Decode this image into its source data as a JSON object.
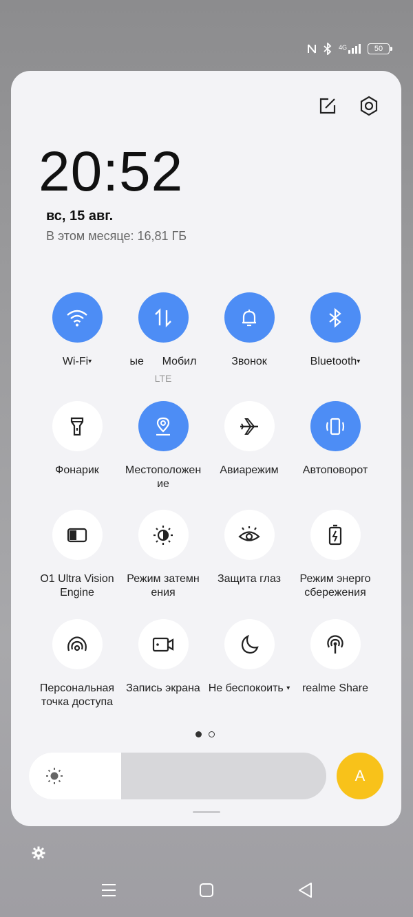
{
  "status_bar": {
    "icons": [
      "nfc-icon",
      "bluetooth-icon",
      "signal-4g-icon"
    ],
    "network": "4G",
    "battery": "50"
  },
  "panel": {
    "edit_icon": "edit-icon",
    "settings_icon": "gear-icon",
    "time": "20:52",
    "date": "вс, 15 авг.",
    "data_usage": "В этом месяце: 16,81 ГБ"
  },
  "tiles": [
    {
      "label": "Wi-Fi",
      "caret": "▾",
      "state": "on",
      "icon": "wifi-icon"
    },
    {
      "label": "ые      Мобил",
      "sub": "LTE",
      "state": "on",
      "icon": "mobile-data-icon"
    },
    {
      "label": "Звонок",
      "state": "on",
      "icon": "bell-icon"
    },
    {
      "label": "Bluetooth",
      "caret": "▾",
      "state": "on",
      "icon": "bluetooth-icon"
    },
    {
      "label": "Фонарик",
      "state": "off",
      "icon": "flashlight-icon"
    },
    {
      "label": "Местоположен\nие",
      "state": "on",
      "icon": "location-icon"
    },
    {
      "label": "Авиарежим",
      "state": "off",
      "icon": "airplane-icon"
    },
    {
      "label": "Автоповорот",
      "state": "on",
      "icon": "auto-rotate-icon"
    },
    {
      "label": "O1 Ultra Vision\nEngine",
      "state": "off",
      "icon": "vision-engine-icon"
    },
    {
      "label": "Режим затемн\nения",
      "state": "off",
      "icon": "dark-mode-icon"
    },
    {
      "label": "Защита глаз",
      "state": "off",
      "icon": "eye-icon"
    },
    {
      "label": "Режим энерго\nсбережения",
      "state": "off",
      "icon": "battery-saver-icon"
    },
    {
      "label": "Персональная\nточка доступа",
      "state": "off",
      "icon": "hotspot-icon"
    },
    {
      "label": "Запись экрана",
      "state": "off",
      "icon": "screen-record-icon"
    },
    {
      "label": "Не беспокоить",
      "caret": "▾",
      "state": "off",
      "icon": "moon-icon"
    },
    {
      "label": "realme Share",
      "state": "off",
      "icon": "realme-share-icon"
    }
  ],
  "pager": {
    "pages": 2,
    "current": 1
  },
  "brightness": {
    "level": 0.31,
    "icon": "sun-icon"
  },
  "auto_brightness": {
    "label": "A"
  },
  "colors": {
    "active_tile": "#4d8df5",
    "inactive_tile": "#ffffff",
    "auto_button": "#f8c21a",
    "panel": "#f3f3f6"
  },
  "bottom": {
    "settings_icon": "gear-icon"
  },
  "navigation": [
    "menu-icon",
    "home-icon",
    "back-icon"
  ]
}
